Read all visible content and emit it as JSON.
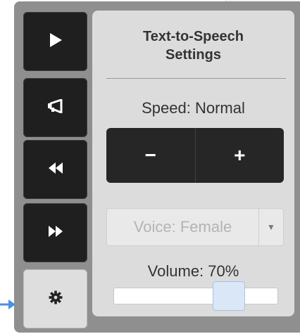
{
  "toolbar": {
    "play_icon": "play-icon",
    "announce_icon": "megaphone-icon",
    "rewind_icon": "rewind-icon",
    "forward_icon": "fast-forward-icon",
    "settings_icon": "gear-icon"
  },
  "settings": {
    "title_line1": "Text-to-Speech",
    "title_line2": "Settings",
    "speed_label": "Speed: Normal",
    "decrease_label": "−",
    "increase_label": "+",
    "voice_value": "Voice: Female",
    "volume_label": "Volume: 70%",
    "volume_percent": 70
  },
  "colors": {
    "button_dark": "#1f1f1f",
    "panel_bg": "#dcdcdc",
    "frame": "#8f8f8f",
    "pointer_arrow": "#4a90e2"
  }
}
